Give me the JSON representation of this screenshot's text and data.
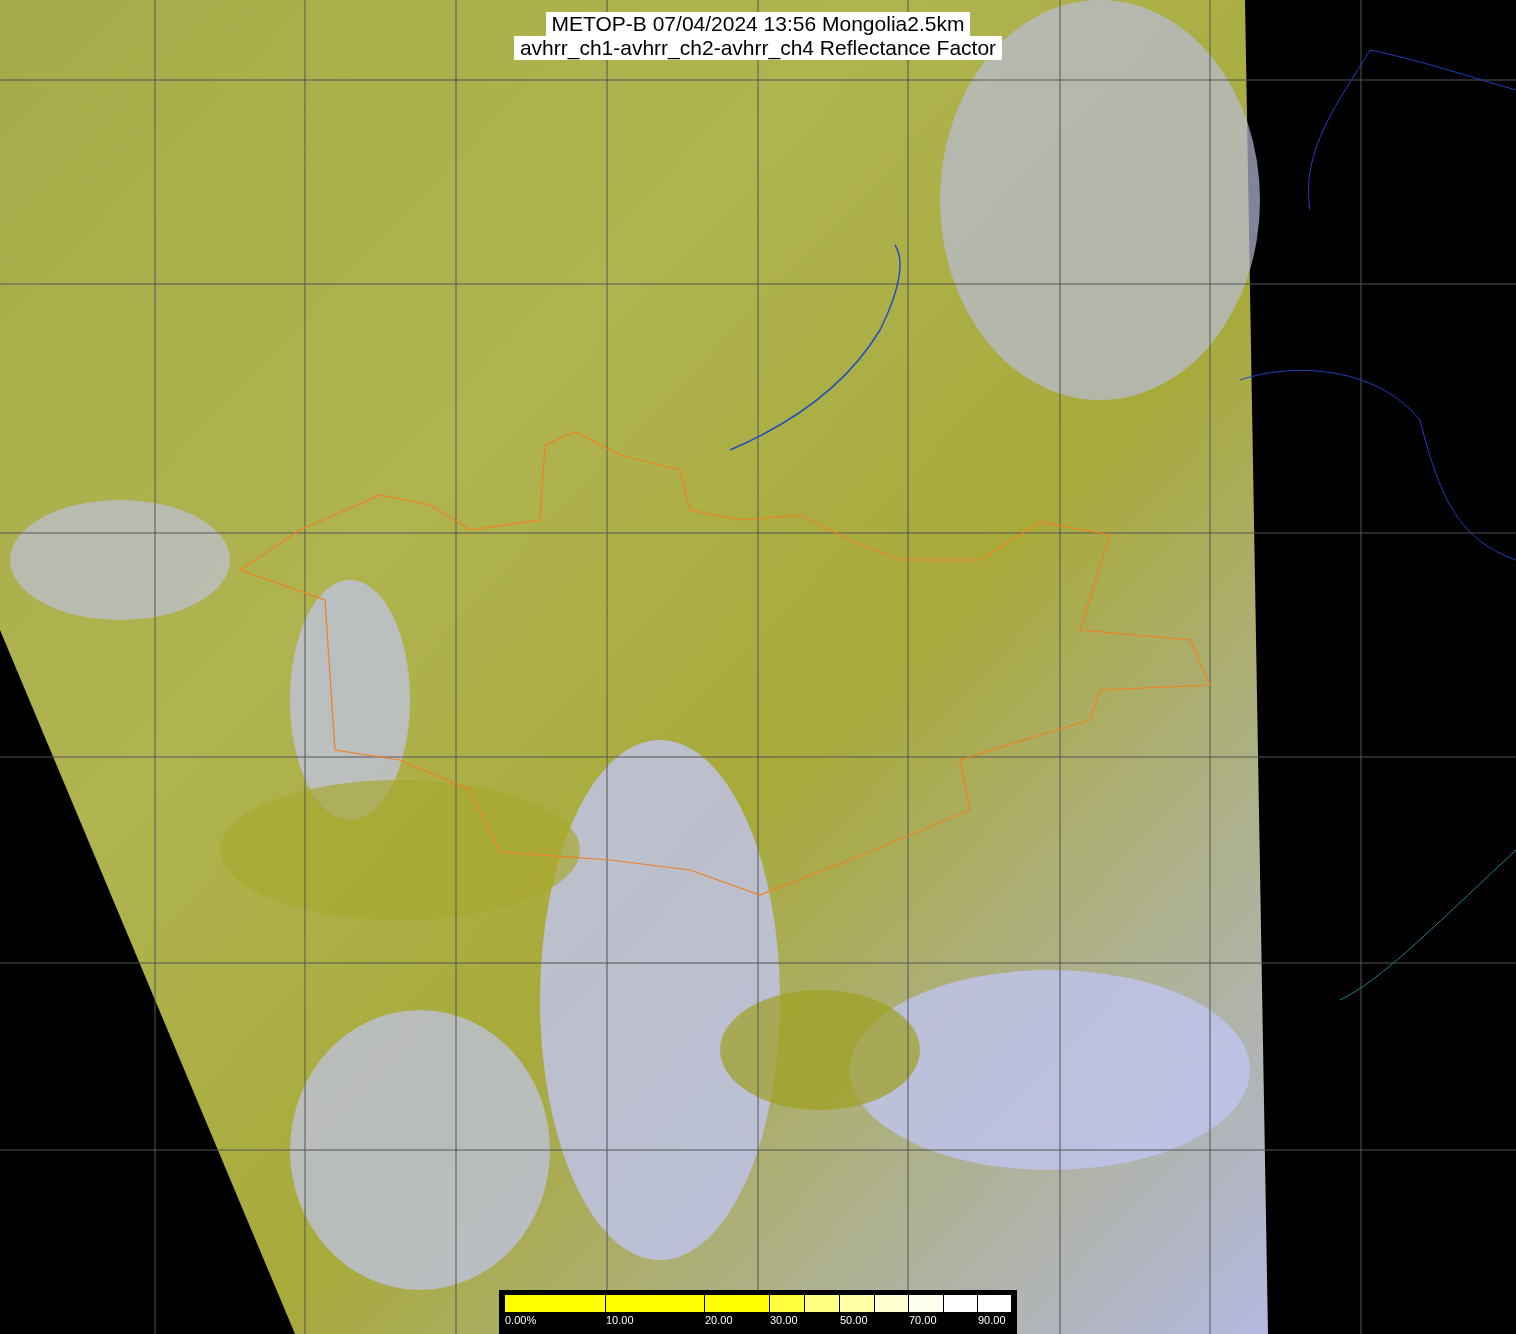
{
  "title": {
    "lines": [
      "METOP-B 07/04/2024 13:56 Mongolia2.5km",
      "avhrr_ch1-avhrr_ch2-avhrr_ch4 Reflectance Factor"
    ]
  },
  "colorbar": {
    "segments": [
      {
        "color": "#ffff00"
      },
      {
        "color": "#ffff00"
      },
      {
        "color": "#ffff00"
      },
      {
        "color": "#ffff40"
      },
      {
        "color": "#ffff80"
      },
      {
        "color": "#ffffa8"
      },
      {
        "color": "#ffffd0"
      },
      {
        "color": "#fffff0"
      },
      {
        "color": "#ffffff"
      }
    ],
    "labels": [
      "0.00%",
      "10.00",
      "20.00",
      "30.00",
      "50.00",
      "70.00",
      "90.00"
    ]
  }
}
